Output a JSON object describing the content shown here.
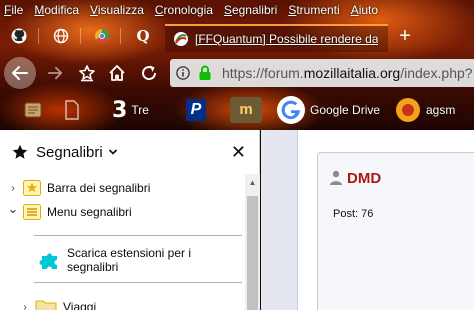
{
  "menu": {
    "items": [
      "File",
      "Modifica",
      "Visualizza",
      "Cronologia",
      "Segnalibri",
      "Strumenti",
      "Aiuto"
    ],
    "underlines": [
      "F",
      "M",
      "V",
      "C",
      "S",
      "S",
      "A"
    ]
  },
  "tabs": {
    "active_title": "[FFQuantum] Possibile rendere da",
    "pinned_icons": [
      "github-icon",
      "globe-icon",
      "chrome-icon",
      "quora-icon"
    ],
    "new_tab_label": "+"
  },
  "navbar": {
    "url_prefix": "https://forum.",
    "url_domain": "mozillaitalia.org",
    "url_suffix": "/index.php?"
  },
  "bookmarks_toolbar": {
    "items": [
      {
        "label": "",
        "icon": "scroll-icon"
      },
      {
        "label": "Tre",
        "icon": "tre-icon"
      },
      {
        "label": "",
        "icon": "paypal-icon"
      },
      {
        "label": "",
        "icon": "mw-icon"
      },
      {
        "label": "Google Drive",
        "icon": "google-icon"
      },
      {
        "label": "agsm",
        "icon": "agsm-icon"
      }
    ]
  },
  "sidebar": {
    "title": "Segnalibri",
    "close_label": "✕",
    "rows": [
      {
        "label": "Barra dei segnalibri",
        "twisty": "›",
        "icon": "bookmark-toolbar-icon"
      },
      {
        "label": "Menu segnalibri",
        "twisty": "⌄",
        "icon": "bookmark-menu-icon"
      },
      {
        "label": "Scarica estensioni per i segnalibri",
        "twisty": "",
        "icon": "puzzle-icon"
      },
      {
        "label": "Viaggi",
        "twisty": "›",
        "icon": "folder-icon"
      }
    ]
  },
  "post": {
    "username": "DMD",
    "post_label": "Post:",
    "post_count": "76"
  },
  "colors": {
    "accent": "#ff9a3a",
    "username": "#aa1a12",
    "tab_close": "#ffffff"
  }
}
